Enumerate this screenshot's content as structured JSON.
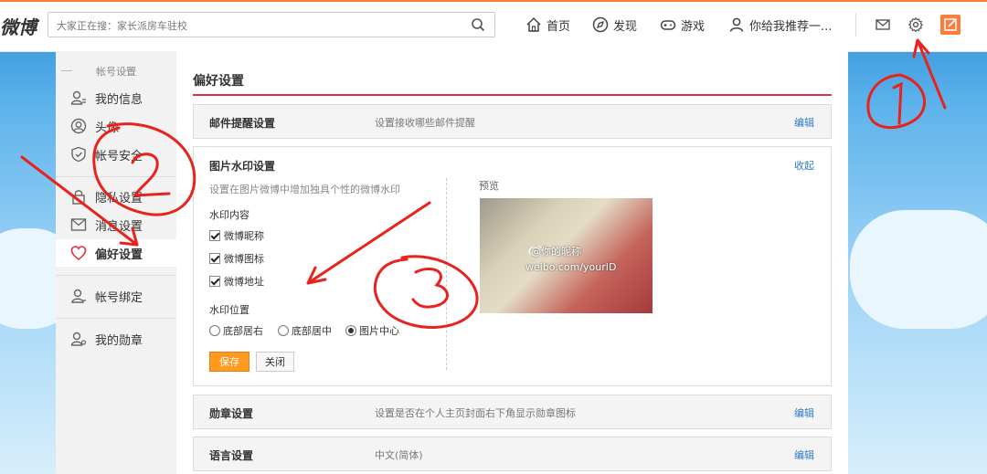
{
  "header": {
    "logo_text": "微博",
    "search_placeholder": "大家正在搜：家长派房车驻校",
    "nav": [
      {
        "label": "首页",
        "icon": "home-icon"
      },
      {
        "label": "发现",
        "icon": "compass-icon"
      },
      {
        "label": "游戏",
        "icon": "gamepad-icon"
      },
      {
        "label": "你给我推荐一...",
        "icon": "user-icon"
      }
    ],
    "right_icons": [
      "mail-icon",
      "gear-icon",
      "compose-icon"
    ]
  },
  "sidebar": {
    "section_title": "帐号设置",
    "items": [
      {
        "label": "我的信息",
        "icon": "person-card-icon"
      },
      {
        "label": "头像",
        "icon": "avatar-icon"
      },
      {
        "label": "帐号安全",
        "icon": "shield-icon"
      },
      {
        "label": "隐私设置",
        "icon": "lock-icon"
      },
      {
        "label": "消息设置",
        "icon": "message-icon"
      },
      {
        "label": "偏好设置",
        "icon": "heart-icon",
        "active": true
      },
      {
        "label": "帐号绑定",
        "icon": "person-link-icon"
      },
      {
        "label": "我的勋章",
        "icon": "medal-person-icon"
      }
    ]
  },
  "main": {
    "title": "偏好设置",
    "email_row": {
      "title": "邮件提醒设置",
      "desc": "设置接收哪些邮件提醒",
      "edit": "编辑"
    },
    "watermark": {
      "title": "图片水印设置",
      "collapse": "收起",
      "desc": "设置在图片微博中增加独具个性的微博水印",
      "content_label": "水印内容",
      "checkboxes": [
        "微博昵称",
        "微博图标",
        "微博地址"
      ],
      "position_label": "水印位置",
      "positions": [
        "底部居右",
        "底部居中",
        "图片中心"
      ],
      "selected_position": "图片中心",
      "save": "保存",
      "close": "关闭",
      "preview_label": "预览",
      "preview_name": "@你的昵称",
      "preview_url": "weibo.com/yourID"
    },
    "medal_row": {
      "title": "勋章设置",
      "desc": "设置是否在个人主页封面右下角显示勋章图标",
      "edit": "编辑"
    },
    "lang_row": {
      "title": "语言设置",
      "desc": "中文(简体)",
      "edit": "编辑"
    }
  },
  "annotations": {
    "colors": {
      "ink": "#e8221c",
      "accent": "#fa7d3c",
      "link": "#2f7bc6"
    }
  }
}
